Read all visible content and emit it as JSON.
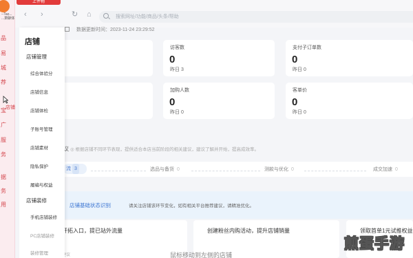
{
  "rail": {
    "shop_name": "--Tao...",
    "shop_sub": "...萧聊体",
    "items": [
      "品",
      "易",
      "城",
      "荐",
      "宝",
      "广",
      "服",
      "务",
      "据",
      "务",
      "用"
    ],
    "active_item": "店铺"
  },
  "topbar": {
    "publish_label": "上件物"
  },
  "browser": {
    "search_placeholder": "搜索网址/功能/商品/头条/帮助"
  },
  "header": {
    "update_time": "数据更新时间：2023-11-24 23:29:52"
  },
  "stats": [
    {
      "label": "访客数",
      "value": "0",
      "yesterday": "昨日 3"
    },
    {
      "label": "支付子订单数",
      "value": "0",
      "yesterday": "昨日 0"
    },
    {
      "label": "加购人数",
      "value": "0",
      "yesterday": "昨日 0"
    },
    {
      "label": "客单价",
      "value": "0",
      "yesterday": "昨日 0"
    }
  ],
  "notice": "◎ 根据店铺不同环节表现，提供适合本店当前阶段的相关建议，建议了解并开始，提高成效率。",
  "progress": {
    "badge_label": "流",
    "badge_count": "3",
    "steps": [
      {
        "label": "选品与备货",
        "count": "0"
      },
      {
        "label": "测款与优化",
        "count": "0"
      },
      {
        "label": "成交加速",
        "count": "0"
      }
    ]
  },
  "banner": {
    "title": "店铺基础状态识别",
    "tip": "请关注店铺该环节变化，如有相关平台推荐建议，请精准优化。"
  },
  "bottom_cards": [
    {
      "title": "开拓入口，提已站外流量",
      "sub": "建议"
    },
    {
      "title": "创建粉丝内购活动，提升店铺销量",
      "sub": ""
    },
    {
      "title": "领取首单1元试推权益",
      "sub": ""
    }
  ],
  "tooltip": "鼠标移动到左侧的店铺",
  "submenu": {
    "title": "店铺",
    "groups": [
      {
        "label": "店铺管理",
        "entries": [
          "综合体验分",
          "店铺信息",
          "店铺体检",
          "子账号管理",
          "店铺素材",
          "隐私保护",
          "履编与权益"
        ]
      },
      {
        "label": "店铺装修",
        "entries": [
          "手机店铺装修",
          "PC店铺装修",
          "装修管理"
        ]
      }
    ]
  },
  "watermark": "煎蛋手游"
}
